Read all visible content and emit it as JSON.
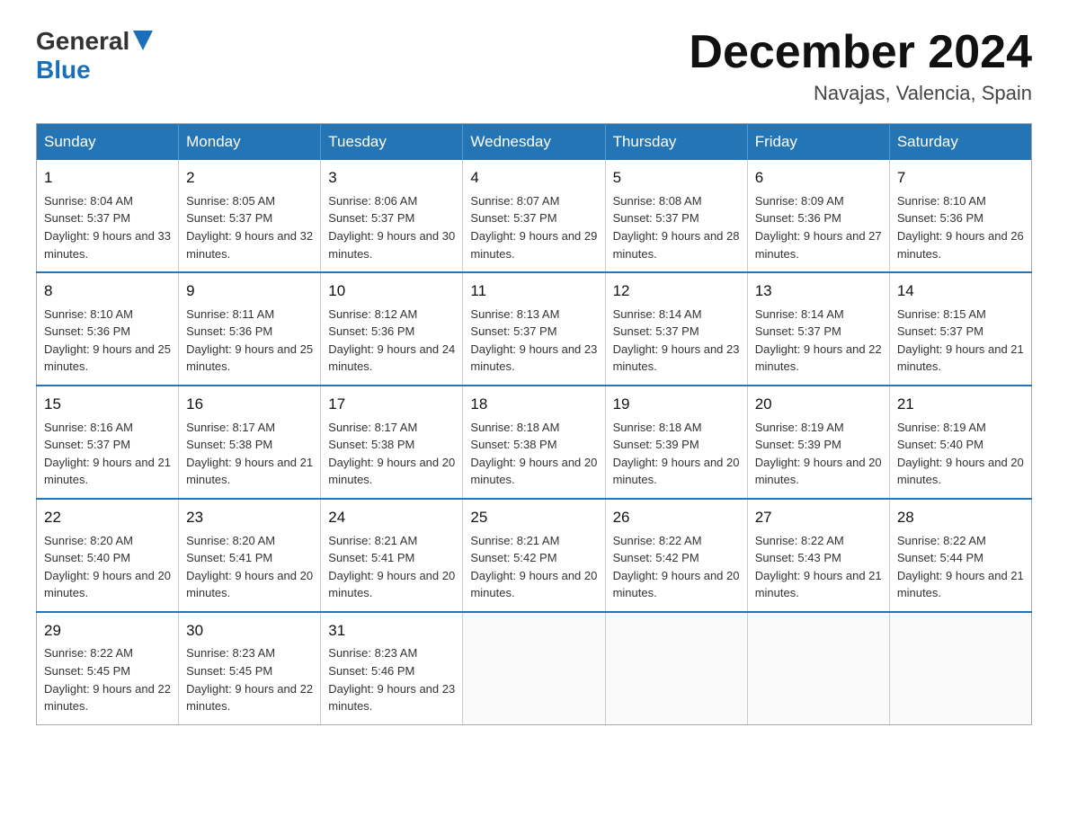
{
  "header": {
    "logo_general": "General",
    "logo_blue": "Blue",
    "month_title": "December 2024",
    "location": "Navajas, Valencia, Spain"
  },
  "weekdays": [
    "Sunday",
    "Monday",
    "Tuesday",
    "Wednesday",
    "Thursday",
    "Friday",
    "Saturday"
  ],
  "weeks": [
    [
      {
        "day": "1",
        "sunrise": "8:04 AM",
        "sunset": "5:37 PM",
        "daylight": "9 hours and 33 minutes."
      },
      {
        "day": "2",
        "sunrise": "8:05 AM",
        "sunset": "5:37 PM",
        "daylight": "9 hours and 32 minutes."
      },
      {
        "day": "3",
        "sunrise": "8:06 AM",
        "sunset": "5:37 PM",
        "daylight": "9 hours and 30 minutes."
      },
      {
        "day": "4",
        "sunrise": "8:07 AM",
        "sunset": "5:37 PM",
        "daylight": "9 hours and 29 minutes."
      },
      {
        "day": "5",
        "sunrise": "8:08 AM",
        "sunset": "5:37 PM",
        "daylight": "9 hours and 28 minutes."
      },
      {
        "day": "6",
        "sunrise": "8:09 AM",
        "sunset": "5:36 PM",
        "daylight": "9 hours and 27 minutes."
      },
      {
        "day": "7",
        "sunrise": "8:10 AM",
        "sunset": "5:36 PM",
        "daylight": "9 hours and 26 minutes."
      }
    ],
    [
      {
        "day": "8",
        "sunrise": "8:10 AM",
        "sunset": "5:36 PM",
        "daylight": "9 hours and 25 minutes."
      },
      {
        "day": "9",
        "sunrise": "8:11 AM",
        "sunset": "5:36 PM",
        "daylight": "9 hours and 25 minutes."
      },
      {
        "day": "10",
        "sunrise": "8:12 AM",
        "sunset": "5:36 PM",
        "daylight": "9 hours and 24 minutes."
      },
      {
        "day": "11",
        "sunrise": "8:13 AM",
        "sunset": "5:37 PM",
        "daylight": "9 hours and 23 minutes."
      },
      {
        "day": "12",
        "sunrise": "8:14 AM",
        "sunset": "5:37 PM",
        "daylight": "9 hours and 23 minutes."
      },
      {
        "day": "13",
        "sunrise": "8:14 AM",
        "sunset": "5:37 PM",
        "daylight": "9 hours and 22 minutes."
      },
      {
        "day": "14",
        "sunrise": "8:15 AM",
        "sunset": "5:37 PM",
        "daylight": "9 hours and 21 minutes."
      }
    ],
    [
      {
        "day": "15",
        "sunrise": "8:16 AM",
        "sunset": "5:37 PM",
        "daylight": "9 hours and 21 minutes."
      },
      {
        "day": "16",
        "sunrise": "8:17 AM",
        "sunset": "5:38 PM",
        "daylight": "9 hours and 21 minutes."
      },
      {
        "day": "17",
        "sunrise": "8:17 AM",
        "sunset": "5:38 PM",
        "daylight": "9 hours and 20 minutes."
      },
      {
        "day": "18",
        "sunrise": "8:18 AM",
        "sunset": "5:38 PM",
        "daylight": "9 hours and 20 minutes."
      },
      {
        "day": "19",
        "sunrise": "8:18 AM",
        "sunset": "5:39 PM",
        "daylight": "9 hours and 20 minutes."
      },
      {
        "day": "20",
        "sunrise": "8:19 AM",
        "sunset": "5:39 PM",
        "daylight": "9 hours and 20 minutes."
      },
      {
        "day": "21",
        "sunrise": "8:19 AM",
        "sunset": "5:40 PM",
        "daylight": "9 hours and 20 minutes."
      }
    ],
    [
      {
        "day": "22",
        "sunrise": "8:20 AM",
        "sunset": "5:40 PM",
        "daylight": "9 hours and 20 minutes."
      },
      {
        "day": "23",
        "sunrise": "8:20 AM",
        "sunset": "5:41 PM",
        "daylight": "9 hours and 20 minutes."
      },
      {
        "day": "24",
        "sunrise": "8:21 AM",
        "sunset": "5:41 PM",
        "daylight": "9 hours and 20 minutes."
      },
      {
        "day": "25",
        "sunrise": "8:21 AM",
        "sunset": "5:42 PM",
        "daylight": "9 hours and 20 minutes."
      },
      {
        "day": "26",
        "sunrise": "8:22 AM",
        "sunset": "5:42 PM",
        "daylight": "9 hours and 20 minutes."
      },
      {
        "day": "27",
        "sunrise": "8:22 AM",
        "sunset": "5:43 PM",
        "daylight": "9 hours and 21 minutes."
      },
      {
        "day": "28",
        "sunrise": "8:22 AM",
        "sunset": "5:44 PM",
        "daylight": "9 hours and 21 minutes."
      }
    ],
    [
      {
        "day": "29",
        "sunrise": "8:22 AM",
        "sunset": "5:45 PM",
        "daylight": "9 hours and 22 minutes."
      },
      {
        "day": "30",
        "sunrise": "8:23 AM",
        "sunset": "5:45 PM",
        "daylight": "9 hours and 22 minutes."
      },
      {
        "day": "31",
        "sunrise": "8:23 AM",
        "sunset": "5:46 PM",
        "daylight": "9 hours and 23 minutes."
      },
      null,
      null,
      null,
      null
    ]
  ],
  "labels": {
    "sunrise_prefix": "Sunrise: ",
    "sunset_prefix": "Sunset: ",
    "daylight_prefix": "Daylight: "
  }
}
